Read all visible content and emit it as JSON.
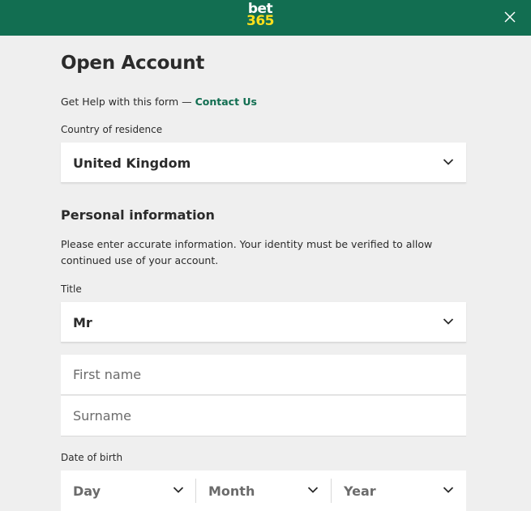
{
  "header": {
    "logo_line1": "bet",
    "logo_line2": "365",
    "brand_color": "#126e51",
    "accent_color": "#ffdf1b"
  },
  "page": {
    "title": "Open Account",
    "help_text": "Get Help with this form — ",
    "help_link": "Contact Us"
  },
  "country": {
    "label": "Country of residence",
    "value": "United Kingdom"
  },
  "personal": {
    "section_title": "Personal information",
    "intro": "Please enter accurate information. Your identity must be verified to allow continued use of your account."
  },
  "title_field": {
    "label": "Title",
    "value": "Mr"
  },
  "first_name": {
    "placeholder": "First name",
    "value": ""
  },
  "surname": {
    "placeholder": "Surname",
    "value": ""
  },
  "dob": {
    "label": "Date of birth",
    "day": "Day",
    "month": "Month",
    "year": "Year"
  },
  "icons": {
    "close": "close-icon",
    "chevron": "chevron-down-icon"
  }
}
